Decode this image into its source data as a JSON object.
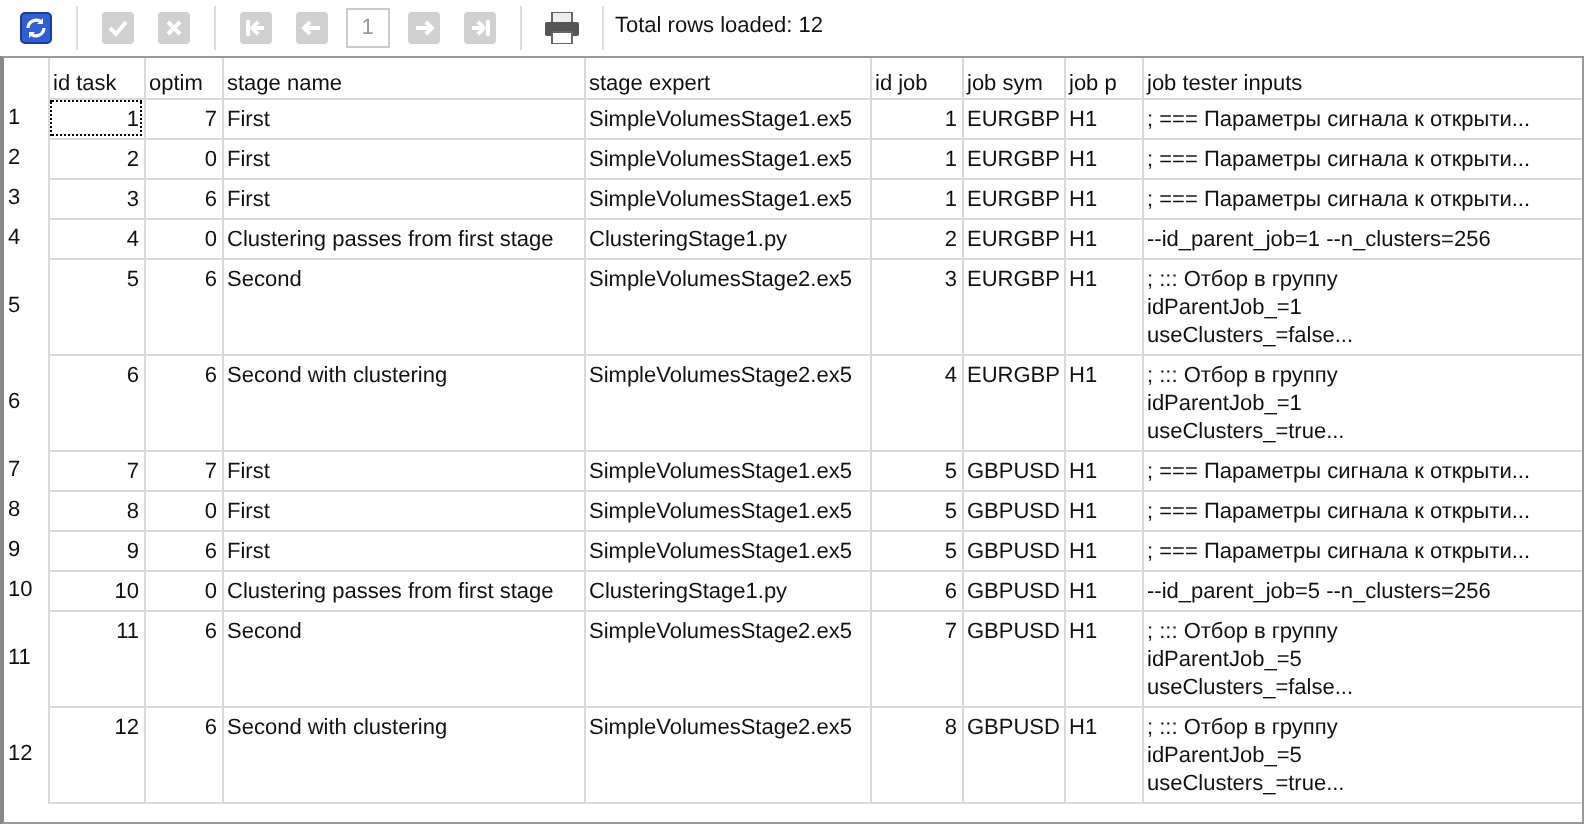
{
  "toolbar": {
    "buttons": [
      {
        "kind": "refresh",
        "disabled": false
      },
      {
        "kind": "check",
        "disabled": true
      },
      {
        "kind": "cancel",
        "disabled": true
      },
      {
        "kind": "first",
        "disabled": true
      },
      {
        "kind": "prev",
        "disabled": true
      },
      {
        "kind": "page",
        "value": "1"
      },
      {
        "kind": "next",
        "disabled": true
      },
      {
        "kind": "last",
        "disabled": true
      },
      {
        "kind": "print",
        "disabled": false
      }
    ],
    "status": "Total rows loaded: 12"
  },
  "table": {
    "columns": [
      {
        "label": "id task",
        "kind": "number"
      },
      {
        "label": "optim",
        "kind": "number"
      },
      {
        "label": "stage name",
        "kind": "text"
      },
      {
        "label": "stage expert",
        "kind": "text"
      },
      {
        "label": "id job",
        "kind": "number"
      },
      {
        "label": "job sym",
        "kind": "text"
      },
      {
        "label": "job p",
        "kind": "text"
      },
      {
        "label": "job tester inputs",
        "kind": "text"
      }
    ],
    "rows": [
      {
        "number": "1",
        "focused": true,
        "cells": [
          "1",
          "7",
          "First",
          "SimpleVolumesStage1.ex5",
          "1",
          "EURGBP",
          "H1",
          [
            "; ===  Параметры сигнала к открыти..."
          ]
        ]
      },
      {
        "number": "2",
        "focused": false,
        "cells": [
          "2",
          "0",
          "First",
          "SimpleVolumesStage1.ex5",
          "1",
          "EURGBP",
          "H1",
          [
            "; ===  Параметры сигнала к открыти..."
          ]
        ]
      },
      {
        "number": "3",
        "focused": false,
        "cells": [
          "3",
          "6",
          "First",
          "SimpleVolumesStage1.ex5",
          "1",
          "EURGBP",
          "H1",
          [
            "; ===  Параметры сигнала к открыти..."
          ]
        ]
      },
      {
        "number": "4",
        "focused": false,
        "cells": [
          "4",
          "0",
          "Clustering passes from first stage",
          "ClusteringStage1.py",
          "2",
          "EURGBP",
          "H1",
          [
            "--id_parent_job=1 --n_clusters=256"
          ]
        ]
      },
      {
        "number": "5",
        "focused": false,
        "cells": [
          "5",
          "6",
          "Second",
          "SimpleVolumesStage2.ex5",
          "3",
          "EURGBP",
          "H1",
          [
            "; ::: Отбор в группу",
            "idParentJob_=1",
            "useClusters_=false..."
          ]
        ]
      },
      {
        "number": "6",
        "focused": false,
        "cells": [
          "6",
          "6",
          "Second with clustering",
          "SimpleVolumesStage2.ex5",
          "4",
          "EURGBP",
          "H1",
          [
            "; ::: Отбор в группу",
            "idParentJob_=1",
            "useClusters_=true..."
          ]
        ]
      },
      {
        "number": "7",
        "focused": false,
        "cells": [
          "7",
          "7",
          "First",
          "SimpleVolumesStage1.ex5",
          "5",
          "GBPUSD",
          "H1",
          [
            "; ===  Параметры сигнала к открыти..."
          ]
        ]
      },
      {
        "number": "8",
        "focused": false,
        "cells": [
          "8",
          "0",
          "First",
          "SimpleVolumesStage1.ex5",
          "5",
          "GBPUSD",
          "H1",
          [
            "; ===  Параметры сигнала к открыти..."
          ]
        ]
      },
      {
        "number": "9",
        "focused": false,
        "cells": [
          "9",
          "6",
          "First",
          "SimpleVolumesStage1.ex5",
          "5",
          "GBPUSD",
          "H1",
          [
            "; ===  Параметры сигнала к открыти..."
          ]
        ]
      },
      {
        "number": "10",
        "focused": false,
        "cells": [
          "10",
          "0",
          "Clustering passes from first stage",
          "ClusteringStage1.py",
          "6",
          "GBPUSD",
          "H1",
          [
            "--id_parent_job=5 --n_clusters=256"
          ]
        ]
      },
      {
        "number": "11",
        "focused": false,
        "cells": [
          "11",
          "6",
          "Second",
          "SimpleVolumesStage2.ex5",
          "7",
          "GBPUSD",
          "H1",
          [
            "; ::: Отбор в группу",
            "idParentJob_=5",
            "useClusters_=false..."
          ]
        ]
      },
      {
        "number": "12",
        "focused": false,
        "cells": [
          "12",
          "6",
          "Second with clustering",
          "SimpleVolumesStage2.ex5",
          "8",
          "GBPUSD",
          "H1",
          [
            "; ::: Отбор в группу",
            "idParentJob_=5",
            "useClusters_=true..."
          ]
        ]
      }
    ]
  }
}
